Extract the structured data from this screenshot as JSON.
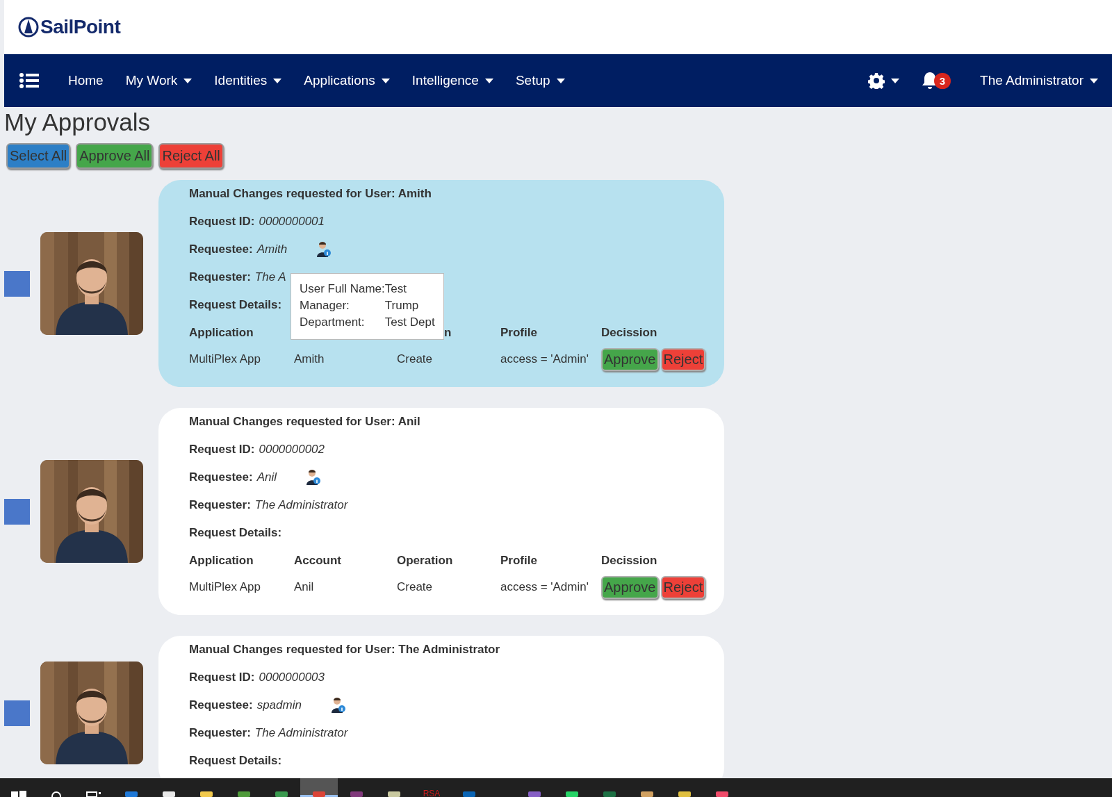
{
  "logo": {
    "text": "SailPoint"
  },
  "nav": {
    "items": [
      {
        "label": "Home",
        "dropdown": false
      },
      {
        "label": "My Work",
        "dropdown": true
      },
      {
        "label": "Identities",
        "dropdown": true
      },
      {
        "label": "Applications",
        "dropdown": true
      },
      {
        "label": "Intelligence",
        "dropdown": true
      },
      {
        "label": "Setup",
        "dropdown": true
      }
    ],
    "notifications": "3",
    "user": "The Administrator"
  },
  "page_title": "My Approvals",
  "bulk_buttons": [
    {
      "label": "Select All",
      "kind": "select"
    },
    {
      "label": "Approve All",
      "kind": "approve"
    },
    {
      "label": "Reject All",
      "kind": "reject"
    }
  ],
  "approvals": [
    {
      "selected": true,
      "checked": false,
      "title": "Manual Changes requested for User: Amith",
      "id_label": "Request ID:",
      "id": "0000000001",
      "requestee_label": "Requestee:",
      "requestee": "Amith",
      "requester_label": "Requester:",
      "requester": "The A",
      "details_label": "Request Details:",
      "headers": [
        {
          "kind": "application",
          "label": "Application"
        },
        {
          "kind": "profile",
          "label": "Profile"
        },
        {
          "kind": "decision",
          "label": "Decission"
        }
      ],
      "row": {
        "application": "MultiPlex App",
        "account": "Amith",
        "operation": "Create",
        "profile": "access = 'Admin'"
      },
      "actions": [
        "Approve",
        "Reject"
      ],
      "tooltip": {
        "rows": [
          {
            "label": "User Full Name:",
            "value": "Test"
          },
          {
            "label": "Manager:",
            "value": "Trump"
          },
          {
            "label": "Department:",
            "value": "Test Dept"
          }
        ],
        "tail": "n"
      }
    },
    {
      "selected": false,
      "checked": false,
      "title": "Manual Changes requested for User: Anil",
      "id_label": "Request ID:",
      "id": "0000000002",
      "requestee_label": "Requestee:",
      "requestee": "Anil",
      "requester_label": "Requester:",
      "requester": "The Administrator",
      "details_label": "Request Details:",
      "headers": [
        {
          "kind": "application",
          "label": "Application"
        },
        {
          "kind": "account",
          "label": "Account"
        },
        {
          "kind": "operation",
          "label": "Operation"
        },
        {
          "kind": "profile",
          "label": "Profile"
        },
        {
          "kind": "decision",
          "label": "Decission"
        }
      ],
      "row": {
        "application": "MultiPlex App",
        "account": "Anil",
        "operation": "Create",
        "profile": "access = 'Admin'"
      },
      "actions": [
        "Approve",
        "Reject"
      ]
    },
    {
      "selected": false,
      "checked": false,
      "title": "Manual Changes requested for User: The Administrator",
      "id_label": "Request ID:",
      "id": "0000000003",
      "requestee_label": "Requestee:",
      "requestee": "spadmin",
      "requester_label": "Requester:",
      "requester": "The Administrator",
      "details_label": "Request Details:"
    }
  ],
  "taskbar": [
    {
      "kind": "windows",
      "selected": false
    },
    {
      "kind": "search",
      "selected": false
    },
    {
      "kind": "taskview",
      "selected": false
    },
    {
      "kind": "app",
      "color": "#1e78d7",
      "selected": false
    },
    {
      "kind": "app",
      "color": "#e8e8e8",
      "selected": false
    },
    {
      "kind": "app",
      "color": "#f2c94c",
      "selected": false
    },
    {
      "kind": "app",
      "color": "#4f9a3a",
      "selected": false
    },
    {
      "kind": "app",
      "color": "#3a9a4f",
      "selected": false
    },
    {
      "kind": "app",
      "color": "#db4437",
      "selected": true
    },
    {
      "kind": "app",
      "color": "#80397b",
      "selected": false
    },
    {
      "kind": "app",
      "color": "#c9c9a0",
      "selected": false
    },
    {
      "kind": "label",
      "text": "RSA",
      "selected": false
    },
    {
      "kind": "app",
      "color": "#0a64b4",
      "selected": false
    },
    {
      "kind": "gap"
    },
    {
      "kind": "app",
      "color": "#865fc5",
      "selected": false
    },
    {
      "kind": "app",
      "color": "#25d366",
      "selected": false
    },
    {
      "kind": "app",
      "color": "#1d7044",
      "selected": false
    },
    {
      "kind": "app",
      "color": "#d0a060",
      "selected": false
    },
    {
      "kind": "app",
      "color": "#e0c040",
      "selected": false
    },
    {
      "kind": "app",
      "color": "#f04b6a",
      "selected": false
    }
  ]
}
